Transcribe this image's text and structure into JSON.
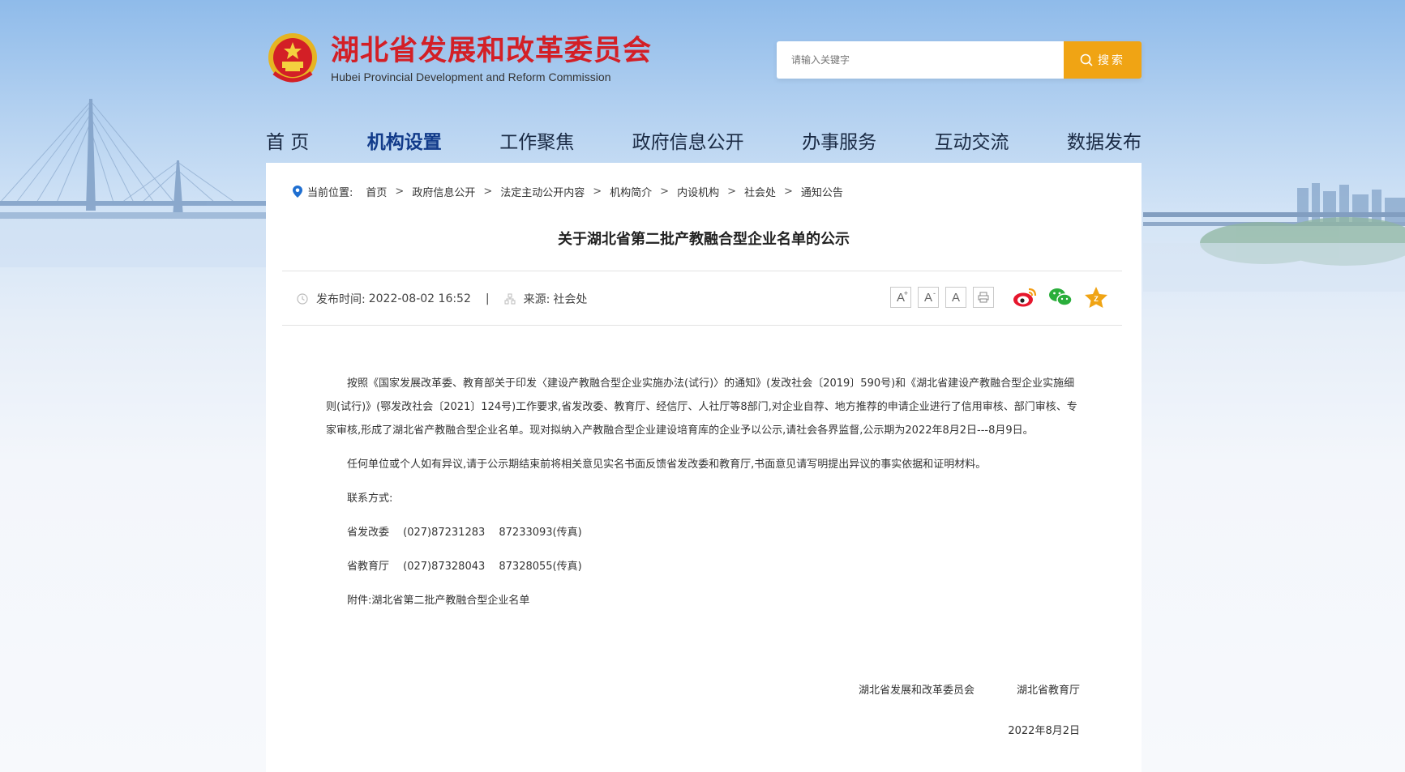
{
  "header": {
    "org_cn": "湖北省发展和改革委员会",
    "org_en": "Hubei Provincial Development and Reform Commission",
    "search_placeholder": "请输入关键字",
    "search_button": "搜索"
  },
  "nav": [
    {
      "label": "首 页"
    },
    {
      "label": "机构设置",
      "active": true
    },
    {
      "label": "工作聚焦"
    },
    {
      "label": "政府信息公开"
    },
    {
      "label": "办事服务"
    },
    {
      "label": "互动交流"
    },
    {
      "label": "数据发布"
    }
  ],
  "breadcrumb": {
    "prefix": "当前位置:",
    "items": [
      "首页",
      "政府信息公开",
      "法定主动公开内容",
      "机构简介",
      "内设机构",
      "社会处",
      "通知公告"
    ],
    "separator": ">"
  },
  "article": {
    "title": "关于湖北省第二批产教融合型企业名单的公示",
    "publish_label": "发布时间:",
    "publish_time": "2022-08-02 16:52",
    "meta_divider": "|",
    "source_label": "来源:",
    "source": "社会处",
    "paragraphs": [
      "按照《国家发展改革委、教育部关于印发〈建设产教融合型企业实施办法(试行)〉的通知》(发改社会〔2019〕590号)和《湖北省建设产教融合型企业实施细则(试行)》(鄂发改社会〔2021〕124号)工作要求,省发改委、教育厅、经信厅、人社厅等8部门,对企业自荐、地方推荐的申请企业进行了信用审核、部门审核、专家审核,形成了湖北省产教融合型企业名单。现对拟纳入产教融合型企业建设培育库的企业予以公示,请社会各界监督,公示期为2022年8月2日---8月9日。",
      "任何单位或个人如有异议,请于公示期结束前将相关意见实名书面反馈省发改委和教育厅,书面意见请写明提出异议的事实依据和证明材料。",
      "联系方式:",
      "省发改委　 (027)87231283　 87233093(传真)",
      "省教育厅　 (027)87328043　 87328055(传真)",
      "附件:湖北省第二批产教融合型企业名单"
    ],
    "signers": [
      "湖北省发展和改革委员会",
      "湖北省教育厅"
    ],
    "date": "2022年8月2日"
  },
  "tools": {
    "font_large": "A",
    "font_large_sup": "+",
    "font_small": "A",
    "font_small_sup": "-",
    "font_reset": "A"
  },
  "icons": [
    "location-pin-icon",
    "clock-icon",
    "source-icon",
    "print-icon",
    "weibo-icon",
    "wechat-icon",
    "favorite-icon",
    "search-icon",
    "national-emblem-icon"
  ],
  "colors": {
    "brand_red": "#d31f26",
    "search_orange": "#f0a414",
    "nav_active": "#123b8a"
  }
}
